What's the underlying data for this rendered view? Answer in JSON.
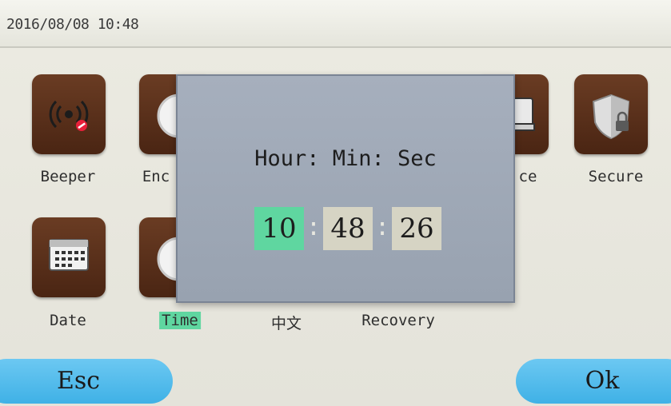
{
  "status_bar": {
    "datetime": "2016/08/08 10:48"
  },
  "menu": {
    "beeper": "Beeper",
    "enc_partial": "Enc",
    "device_partial": "ce",
    "secure": "Secure",
    "date": "Date",
    "time": "Time",
    "chinese": "中文",
    "recovery": "Recovery"
  },
  "time_dialog": {
    "header": "Hour: Min: Sec",
    "hour": "10",
    "min": "48",
    "sec": "26",
    "separator": ":"
  },
  "buttons": {
    "esc": "Esc",
    "ok": "Ok"
  },
  "colors": {
    "tile": "#5a301b",
    "selected": "#5fd6a0",
    "button": "#4ab9ea",
    "dialog": "#a0a9b7"
  },
  "icons": [
    "beeper-icon",
    "encoding-icon",
    "device-icon",
    "secure-shield-icon",
    "calendar-icon",
    "clock-icon"
  ]
}
